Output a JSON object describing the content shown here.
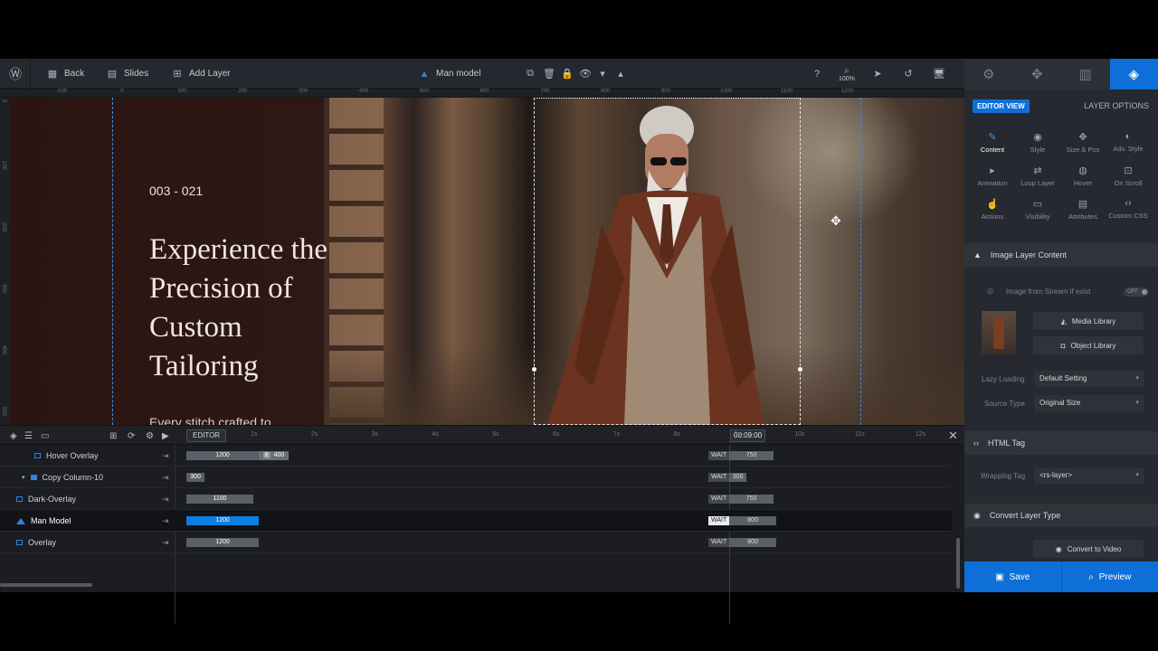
{
  "toolbar": {
    "back": "Back",
    "slides": "Slides",
    "add_layer": "Add Layer",
    "layer_name": "Man model",
    "zoom": "100%"
  },
  "ruler": {
    "h_ticks": [
      "-100",
      "0",
      "100",
      "200",
      "300",
      "400",
      "500",
      "600",
      "700",
      "800",
      "900",
      "1000",
      "1100",
      "1200"
    ],
    "v_ticks": [
      "0",
      "100",
      "200",
      "300",
      "400",
      "500"
    ]
  },
  "slide": {
    "number": "003 - 021",
    "title": "Experience the Precision of Custom Tailoring",
    "subtitle": "Every stitch crafted to"
  },
  "timeline": {
    "editor_label": "EDITOR",
    "seconds": [
      "1s",
      "2s",
      "3s",
      "4s",
      "5s",
      "6s",
      "7s",
      "8s",
      "9s",
      "10s",
      "11s",
      "12s"
    ],
    "current_time": "00:09:00",
    "wait_label": "WAIT",
    "layers": [
      {
        "name": "Hover Overlay",
        "start": "1200",
        "extra": "400",
        "wait": "750",
        "active": false
      },
      {
        "name": "Copy Column-10",
        "start": "300",
        "wait": "300",
        "active": false
      },
      {
        "name": "Dark-Overlay",
        "start": "1100",
        "wait": "750",
        "active": false
      },
      {
        "name": "Man Model",
        "start": "1200",
        "wait": "800",
        "active": true
      },
      {
        "name": "Overlay",
        "start": "1200",
        "wait": "800",
        "active": false
      }
    ]
  },
  "panel": {
    "editor_view": "EDITOR VIEW",
    "layer_options": "LAYER OPTIONS",
    "options": [
      {
        "label": "Content",
        "icon": "pencil-icon"
      },
      {
        "label": "Style",
        "icon": "palette-icon"
      },
      {
        "label": "Size & Pos",
        "icon": "move-icon"
      },
      {
        "label": "Adv. Style",
        "icon": "contrast-icon"
      },
      {
        "label": "Animation",
        "icon": "play-icon"
      },
      {
        "label": "Loop Layer",
        "icon": "loop-icon"
      },
      {
        "label": "Hover",
        "icon": "mouse-icon"
      },
      {
        "label": "On Scroll",
        "icon": "scroll-icon"
      },
      {
        "label": "Actions",
        "icon": "hand-icon"
      },
      {
        "label": "Visibility",
        "icon": "monitor-icon"
      },
      {
        "label": "Attributes",
        "icon": "document-icon"
      },
      {
        "label": "Custom CSS",
        "icon": "code-icon"
      }
    ],
    "image_section": "Image Layer Content",
    "stream_label": "Image from Stream if exist",
    "stream_toggle": "OFF",
    "media_library": "Media Library",
    "object_library": "Object Library",
    "lazy_label": "Lazy Loading",
    "lazy_value": "Default Setting",
    "source_label": "Source Type",
    "source_value": "Original Size",
    "html_section": "HTML Tag",
    "wrap_label": "Wrapping Tag",
    "wrap_value": "<rs-layer>",
    "convert_section": "Convert Layer Type",
    "convert_video": "Convert to Video",
    "save": "Save",
    "preview": "Preview"
  },
  "colors": {
    "accent": "#0e6fd8",
    "timeline_bar": "#0e7de3",
    "slide_bg": "#2b1714"
  }
}
